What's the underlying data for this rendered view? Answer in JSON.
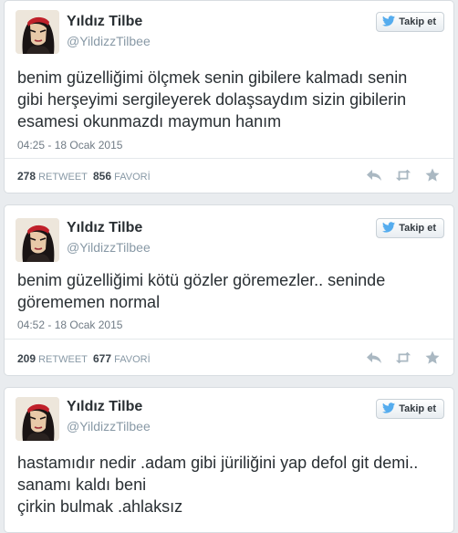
{
  "profile": {
    "name": "Yıldız Tilbe",
    "handle": "@YildizzTilbee",
    "follow_label": "Takip et"
  },
  "tweets": [
    {
      "text_lines": [
        "benim güzelliğimi ölçmek senin gibilere kalmadı senin",
        "gibi herşeyimi sergileyerek dolaşsaydım sizin gibilerin",
        "esamesi okunmazdı maymun hanım"
      ],
      "time": "04:25 - 18 Ocak 2015",
      "retweets": "278",
      "retweet_label": "RETWEET",
      "favorites": "856",
      "favorite_label": "FAVORİ"
    },
    {
      "text_lines": [
        "benim güzelliğimi kötü gözler göremezler.. seninde",
        "görememen normal"
      ],
      "time": "04:52 - 18 Ocak 2015",
      "retweets": "209",
      "retweet_label": "RETWEET",
      "favorites": "677",
      "favorite_label": "FAVORİ"
    },
    {
      "text_lines": [
        "hastamıdır nedir .adam gibi jüriliğini yap defol git demi..",
        "sanamı kaldı beni",
        "çirkin bulmak .ahlaksız"
      ]
    }
  ],
  "icons": [
    "bird-icon",
    "reply-icon",
    "retweet-icon",
    "favorite-star-icon"
  ],
  "colors": {
    "twitter_blue": "#55acee",
    "text": "#292f33",
    "muted": "#8899a6",
    "action_gray": "#aab8c2"
  }
}
